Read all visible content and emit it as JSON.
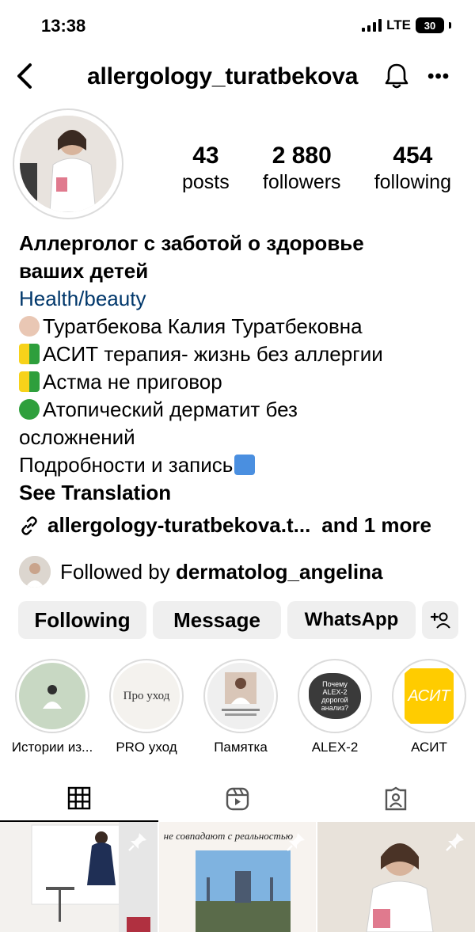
{
  "status_bar": {
    "time": "13:38",
    "network": "LTE",
    "battery": "30"
  },
  "header": {
    "username": "allergology_turatbekova",
    "bell_icon": "bell-icon",
    "more_icon": "more-icon"
  },
  "profile": {
    "stats": [
      {
        "value": "43",
        "label": "posts"
      },
      {
        "value": "2 880",
        "label": "followers"
      },
      {
        "value": "454",
        "label": "following"
      }
    ],
    "bio": {
      "name_line1": "Аллерголог с заботой о здоровье",
      "name_line2": "ваших детей",
      "category": "Health/beauty",
      "lines": [
        "Туратбекова Калия Туратбековна",
        "АСИТ терапия- жизнь без аллергии",
        "Астма не приговор",
        "Атопический дерматит без",
        "осложнений",
        "Подробности и запись"
      ],
      "see_translation": "See Translation"
    },
    "link": {
      "text": "allergology-turatbekova.t...",
      "more": "and 1 more"
    },
    "followed_by": {
      "prefix": "Followed by ",
      "user": "dermatolog_angelina"
    }
  },
  "buttons": {
    "following": "Following",
    "message": "Message",
    "whatsapp": "WhatsApp"
  },
  "highlights": [
    {
      "label": "Истории из...",
      "bg": "#c8d8c3"
    },
    {
      "label": "PRO уход",
      "bg": "#f4f2ee",
      "inner_text": "Про уход"
    },
    {
      "label": "Памятка",
      "bg": "#e6e6e6"
    },
    {
      "label": "ALEX-2",
      "bg": "#3a3a3a",
      "inner_text": "Почему ALEX-2 дорогой анализ?"
    },
    {
      "label": "АСИТ",
      "bg": "#ffcc00",
      "inner_text": "АСИТ"
    }
  ],
  "grid": {
    "post2_text": "не совпадают с реальностью"
  },
  "colors": {
    "link_blue": "#00376b",
    "button_bg": "#efefef",
    "border": "#dbdbdb"
  }
}
